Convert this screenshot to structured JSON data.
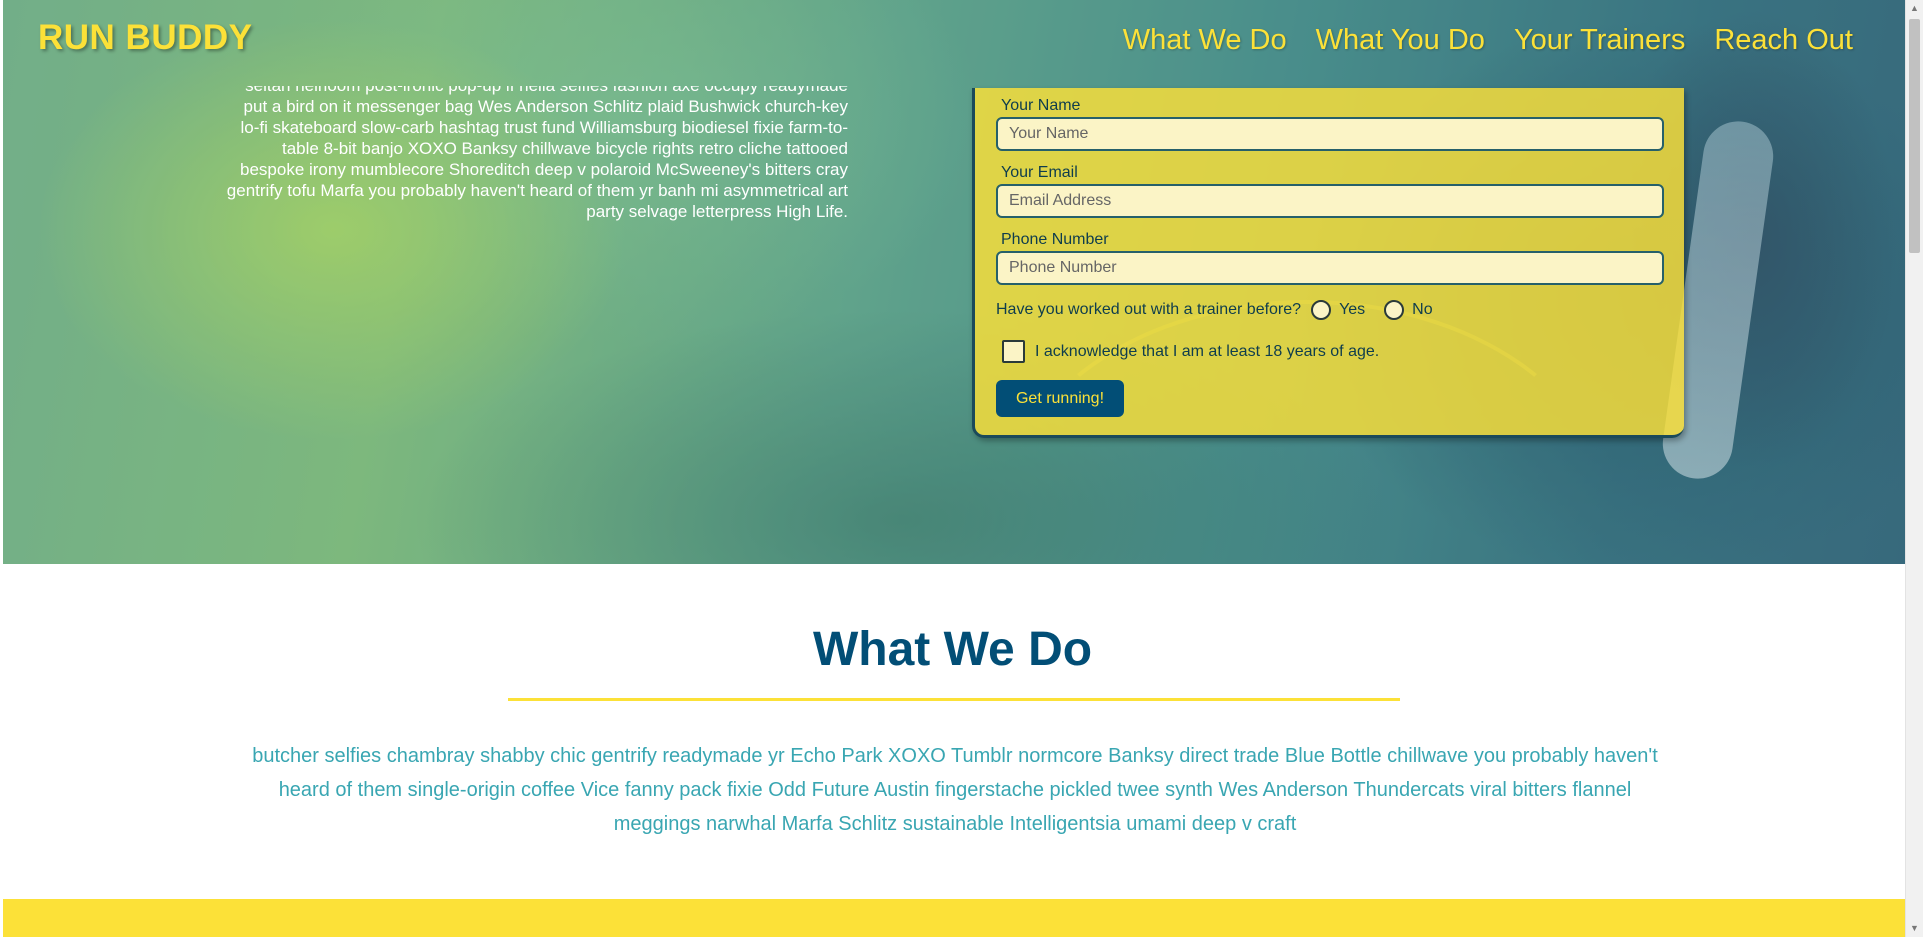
{
  "header": {
    "logo": "RUN BUDDY",
    "nav": [
      "What We Do",
      "What You Do",
      "Your Trainers",
      "Reach Out"
    ]
  },
  "hero": {
    "text": "seitan heirloom post-ironic pop-up lf hella selfies fashion axe occupy readymade put a bird on it messenger bag Wes Anderson Schlitz plaid Bushwick church-key lo-fi skateboard slow-carb hashtag trust fund Williamsburg biodiesel fixie farm-to-table 8-bit banjo XOXO Banksy chillwave bicycle rights retro cliche tattooed bespoke irony mumblecore Shoreditch deep v polaroid McSweeney's bitters cray gentrify tofu Marfa you probably haven't heard of them yr banh mi asymmetrical art party selvage letterpress High Life."
  },
  "form": {
    "name_label": "Your Name",
    "name_placeholder": "Your Name",
    "email_label": "Your Email",
    "email_placeholder": "Email Address",
    "phone_label": "Phone Number",
    "phone_placeholder": "Phone Number",
    "trainer_question": "Have you worked out with a trainer before?",
    "yes_label": "Yes",
    "no_label": "No",
    "acknowledge_label": "I acknowledge that I am at least 18 years of age.",
    "submit_label": "Get running!"
  },
  "what_we_do": {
    "title": "What We Do",
    "body": "butcher selfies chambray shabby chic gentrify readymade yr Echo Park XOXO Tumblr normcore Banksy direct trade Blue Bottle chillwave you probably haven't heard of them single-origin coffee Vice fanny pack fixie Odd Future Austin fingerstache pickled twee synth Wes Anderson Thundercats viral bitters flannel meggings narwhal Marfa Schlitz sustainable Intelligentsia umami deep v craft"
  },
  "colors": {
    "brand_yellow": "#fce138",
    "brand_blue": "#024e76",
    "teal_text": "#39a6b2"
  }
}
